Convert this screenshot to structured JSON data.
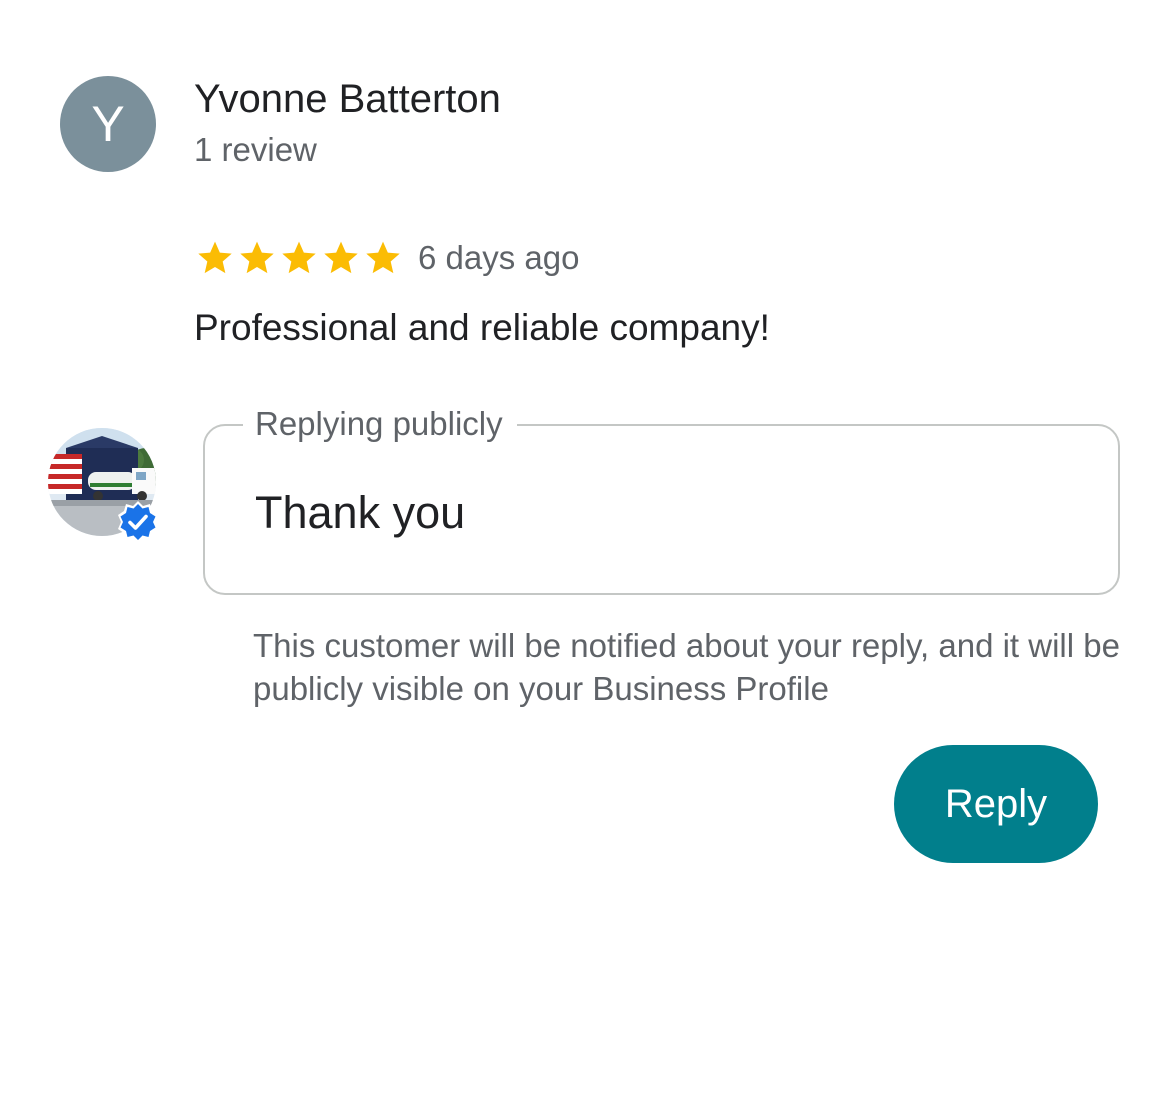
{
  "reviewer": {
    "initial": "Y",
    "name": "Yvonne Batterton",
    "review_count": "1 review",
    "avatar_color": "#7b909b"
  },
  "review": {
    "rating": 5,
    "max_rating": 5,
    "star_color": "#fbbc04",
    "date": "6 days ago",
    "text": "Professional and reliable company!"
  },
  "owner": {
    "avatar_icon": "business-photo-icon",
    "verified_icon": "verified-badge-icon",
    "verified_color": "#1a73e8"
  },
  "reply_form": {
    "legend": "Replying publicly",
    "value": "Thank you",
    "notice": "This customer will be notified about your reply, and it will be publicly visible on your Business Profile",
    "submit_label": "Reply",
    "accent_color": "#017f8c"
  }
}
